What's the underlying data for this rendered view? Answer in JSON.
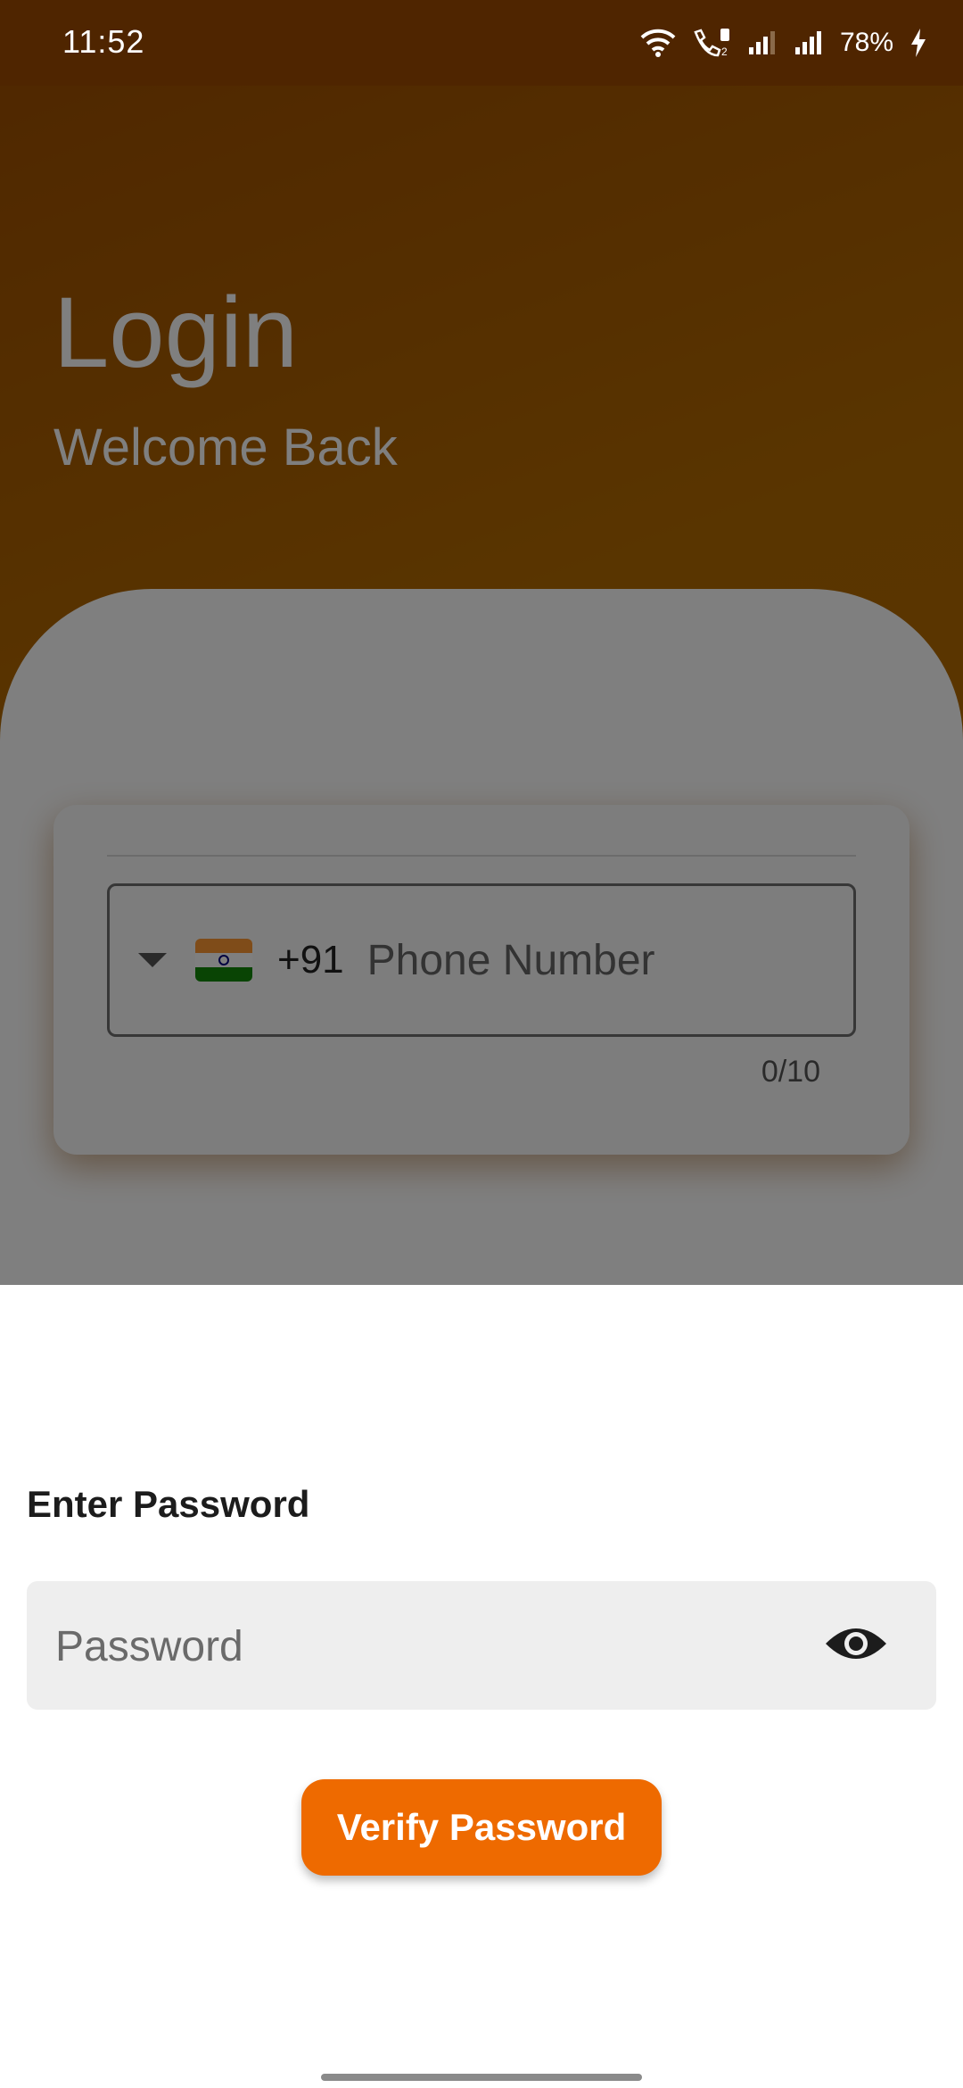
{
  "status_bar": {
    "time": "11:52",
    "battery": "78%",
    "icons": [
      "wifi-icon",
      "wifi-calling-icon",
      "signal-sim1-icon",
      "signal-sim2-icon",
      "charging-icon"
    ]
  },
  "login": {
    "title": "Login",
    "subtitle": "Welcome Back"
  },
  "phone": {
    "country_flag": "india-flag-icon",
    "dial_code": "+91",
    "placeholder": "Phone Number",
    "counter": "0/10"
  },
  "sheet": {
    "title": "Enter Password",
    "password_placeholder": "Password",
    "toggle_icon": "eye-icon",
    "verify_label": "Verify Password"
  },
  "colors": {
    "accent": "#ee6a00",
    "header_gradient_start": "#a05000",
    "status_bar": "#4f2500"
  }
}
